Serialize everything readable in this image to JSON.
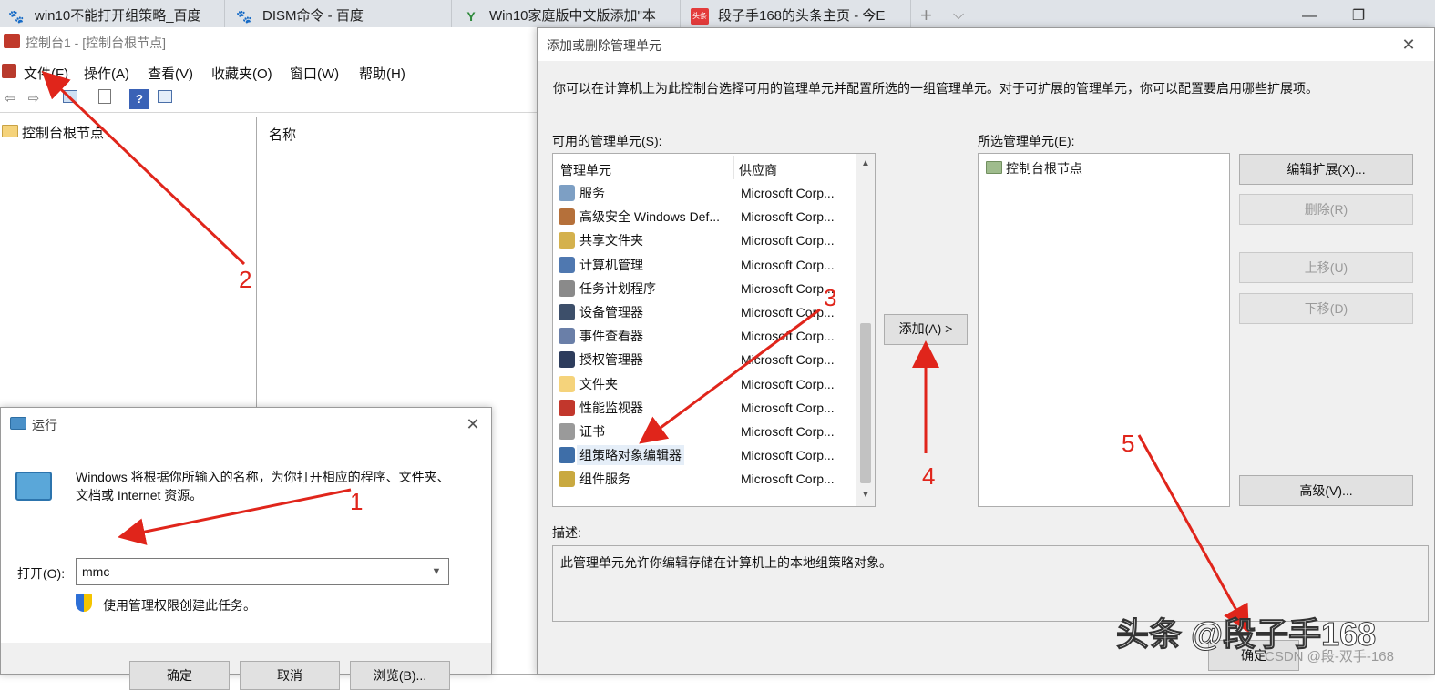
{
  "browser": {
    "tabs": [
      {
        "title": "win10不能打开组策略_百度",
        "icon": "baidu-paw-icon"
      },
      {
        "title": "DISM命令 - 百度",
        "icon": "baidu-paw-icon"
      },
      {
        "title": "Win10家庭版中文版添加\"本",
        "icon": "green-y-icon"
      },
      {
        "title": "段子手168的头条主页 - 今E",
        "icon": "toutiao-icon"
      }
    ],
    "new_tab": "+",
    "tab_list": "⌵",
    "minimize": "—",
    "restore": "❐"
  },
  "mmc": {
    "title": "控制台1 - [控制台根节点]",
    "menu": [
      "文件(F)",
      "操作(A)",
      "查看(V)",
      "收藏夹(O)",
      "窗口(W)",
      "帮助(H)"
    ],
    "toolbar": {
      "back": "⇦",
      "forward": "⇨",
      "help": "?"
    },
    "tree_root": "控制台根节点",
    "list_header": "名称"
  },
  "run": {
    "title": "运行",
    "close": "✕",
    "description": "Windows 将根据你所输入的名称，为你打开相应的程序、文件夹、文档或 Internet 资源。",
    "open_label": "打开(O):",
    "open_value": "mmc",
    "admin_text": "使用管理权限创建此任务。",
    "ok": "确定",
    "cancel": "取消",
    "browse": "浏览(B)..."
  },
  "snapin": {
    "title": "添加或删除管理单元",
    "close": "✕",
    "intro": "你可以在计算机上为此控制台选择可用的管理单元并配置所选的一组管理单元。对于可扩展的管理单元，你可以配置要启用哪些扩展项。",
    "available_label": "可用的管理单元(S):",
    "col_name": "管理单元",
    "col_vendor": "供应商",
    "items": [
      {
        "name": "服务",
        "vendor": "Microsoft Corp...",
        "icon": "services-gear-icon",
        "color": "#7d9fc4"
      },
      {
        "name": "高级安全 Windows Def...",
        "vendor": "Microsoft Corp...",
        "icon": "firewall-icon",
        "color": "#b5703a"
      },
      {
        "name": "共享文件夹",
        "vendor": "Microsoft Corp...",
        "icon": "shared-folder-icon",
        "color": "#d4b14d"
      },
      {
        "name": "计算机管理",
        "vendor": "Microsoft Corp...",
        "icon": "computer-management-icon",
        "color": "#4f78b0"
      },
      {
        "name": "任务计划程序",
        "vendor": "Microsoft Corp...",
        "icon": "clock-icon",
        "color": "#8a8a8a"
      },
      {
        "name": "设备管理器",
        "vendor": "Microsoft Corp...",
        "icon": "device-manager-icon",
        "color": "#3d4f6a"
      },
      {
        "name": "事件查看器",
        "vendor": "Microsoft Corp...",
        "icon": "event-viewer-icon",
        "color": "#6a7fa8"
      },
      {
        "name": "授权管理器",
        "vendor": "Microsoft Corp...",
        "icon": "authorization-icon",
        "color": "#2d3c5c"
      },
      {
        "name": "文件夹",
        "vendor": "Microsoft Corp...",
        "icon": "folder-icon",
        "color": "#f5d37b"
      },
      {
        "name": "性能监视器",
        "vendor": "Microsoft Corp...",
        "icon": "performance-monitor-icon",
        "color": "#c2372c"
      },
      {
        "name": "证书",
        "vendor": "Microsoft Corp...",
        "icon": "certificate-icon",
        "color": "#9a9a9a"
      },
      {
        "name": "组策略对象编辑器",
        "vendor": "Microsoft Corp...",
        "icon": "group-policy-icon",
        "color": "#3e6ea8"
      },
      {
        "name": "组件服务",
        "vendor": "Microsoft Corp...",
        "icon": "component-services-icon",
        "color": "#c9a940"
      }
    ],
    "selected_index": 11,
    "add_button": "添加(A) >",
    "selected_label": "所选管理单元(E):",
    "selected_items": [
      "控制台根节点"
    ],
    "edit_ext": "编辑扩展(X)...",
    "remove": "删除(R)",
    "move_up": "上移(U)",
    "move_down": "下移(D)",
    "advanced": "高级(V)...",
    "description_label": "描述:",
    "description": "此管理单元允许你编辑存储在计算机上的本地组策略对象。",
    "ok_partial": "确定"
  },
  "annotations": {
    "steps": [
      "1",
      "2",
      "3",
      "4",
      "5"
    ],
    "arrow_color": "#e0251b",
    "watermark": "头条 @段子手168",
    "csdn": "CSDN @段-双手-168"
  }
}
